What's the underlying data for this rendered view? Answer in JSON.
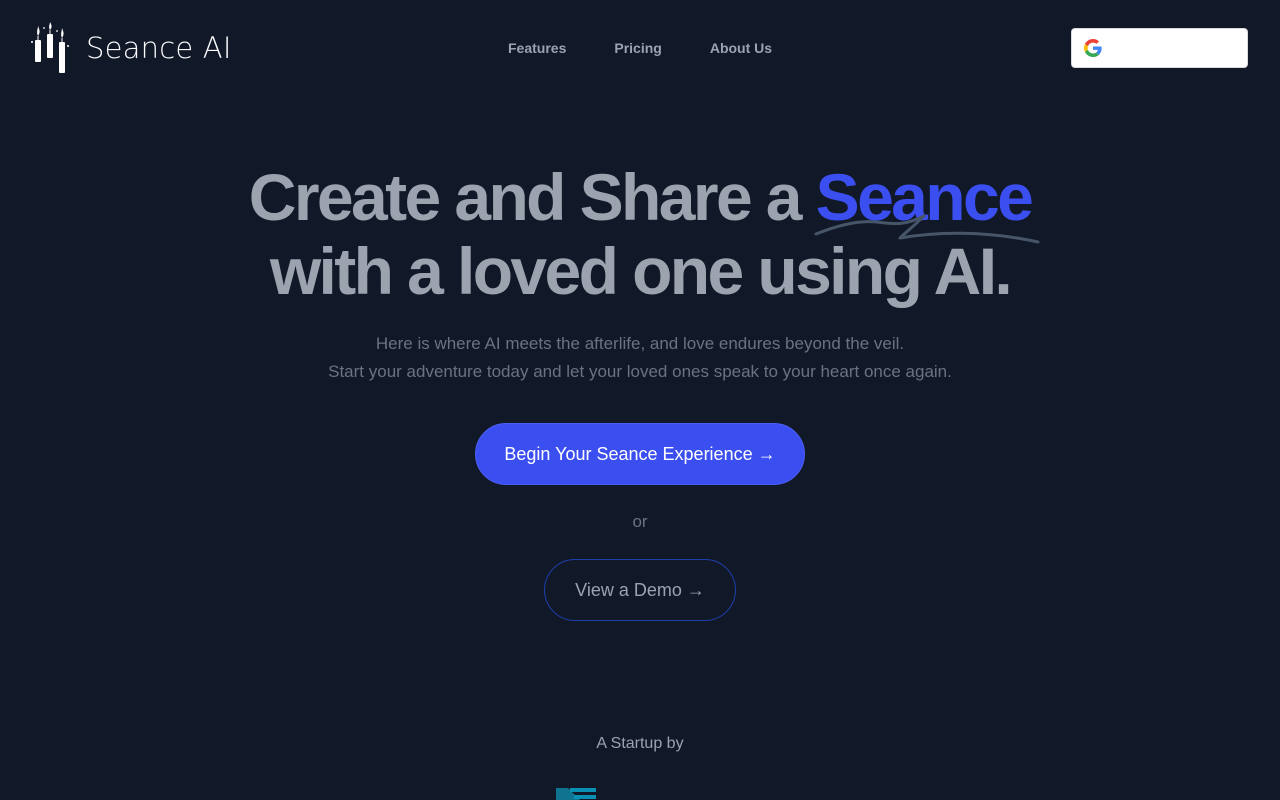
{
  "brand": {
    "name": "Seance AI",
    "accent_color": "#3b4ef0"
  },
  "nav": {
    "items": [
      {
        "label": "Features"
      },
      {
        "label": "Pricing"
      },
      {
        "label": "About Us"
      }
    ]
  },
  "auth": {
    "google_icon": "google-logo-icon",
    "label": ""
  },
  "hero": {
    "headline_part1": "Create and Share a ",
    "headline_highlight": "Seance",
    "headline_line2": "with a loved one using AI.",
    "subtitle_line1": "Here is where AI meets the afterlife, and love endures beyond the veil.",
    "subtitle_line2": "Start your adventure today and let your loved ones speak to your heart once again.",
    "primary_cta": "Begin Your Seance Experience →",
    "separator": "or",
    "secondary_cta": "View a Demo →"
  },
  "footer": {
    "startup_by": "A Startup by",
    "startup_logo_icon": "company-logo-icon"
  }
}
